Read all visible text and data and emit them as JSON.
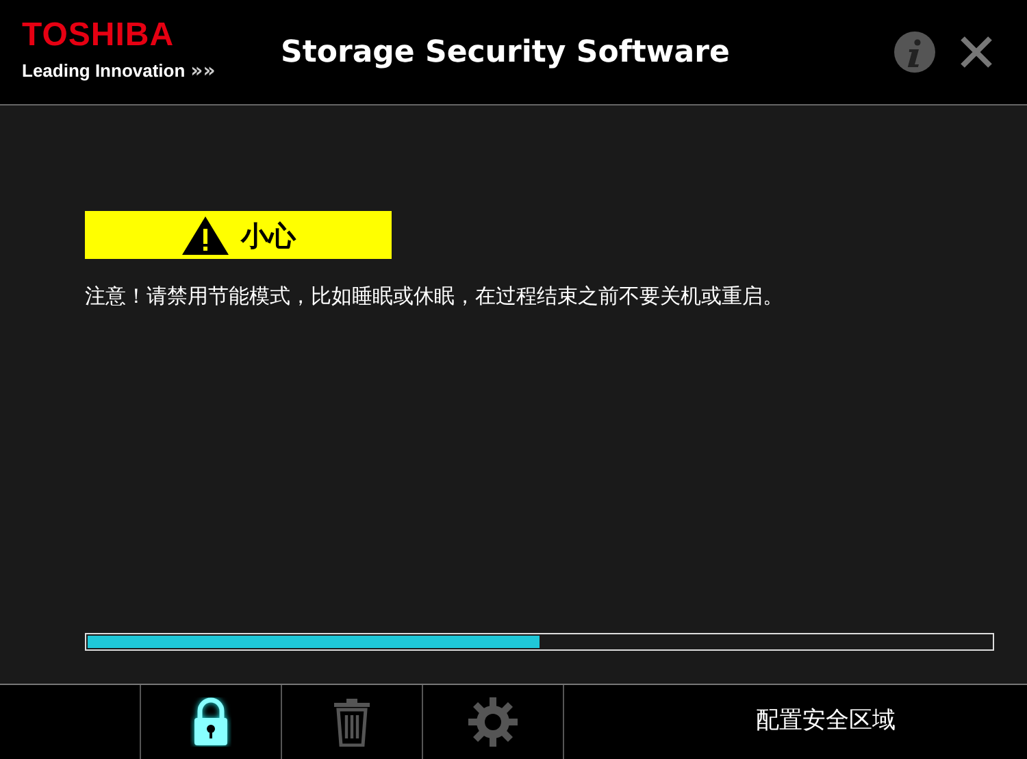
{
  "header": {
    "brand": "TOSHIBA",
    "tagline": "Leading Innovation",
    "tagline_mark": "»»",
    "title": "Storage Security Software"
  },
  "caution": {
    "label": "小心",
    "message": "注意！请禁用节能模式，比如睡眠或休眠，在过程结束之前不要关机或重启。"
  },
  "progress": {
    "level": 0.5
  },
  "toolbar": [
    {
      "kind": "lock",
      "selected": true
    },
    {
      "kind": "trash",
      "selected": false
    },
    {
      "kind": "gear",
      "selected": false
    }
  ],
  "status": "配置安全区域"
}
